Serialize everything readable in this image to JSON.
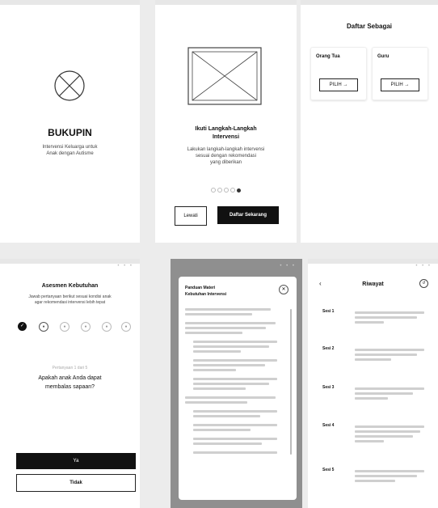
{
  "s1": {
    "app_title": "BUKUPIN",
    "subtitle_line1": "Intervensi Keluarga untuk",
    "subtitle_line2": "Anak dengan Autisme"
  },
  "s2": {
    "heading_line1": "Ikuti Langkah-Langkah",
    "heading_line2": "Intervensi",
    "desc_line1": "Lakukan langkah-langkah intervensi",
    "desc_line2": "sesuai dengan rekomendasi",
    "desc_line3": "yang diberikan",
    "skip_label": "Lewati",
    "register_label": "Daftar Sekarang"
  },
  "s3": {
    "title": "Daftar Sebagai",
    "cards": [
      {
        "label": "Orang Tua",
        "button": "PILIH →"
      },
      {
        "label": "Guru",
        "button": "PILIH →"
      }
    ]
  },
  "s4": {
    "title": "Asesmen Kebutuhan",
    "desc_line1": "Jawab pertanyaan berikut sesuai kondisi anak",
    "desc_line2": "agar rekomendasi intervensi lebih tepat",
    "progress_text": "Pertanyaan 1 dari 5",
    "question_line1": "Apakah anak Anda dapat",
    "question_line2": "membalas sapaan?",
    "yes_label": "Ya",
    "no_label": "Tidak"
  },
  "s5": {
    "header_line1": "Panduan Materi",
    "header_line2": "Kebutuhan Intervensi"
  },
  "s6": {
    "title": "Riwayat",
    "sessions": [
      "Sesi 1",
      "Sesi 2",
      "Sesi 3",
      "Sesi 4",
      "Sesi 5"
    ]
  }
}
